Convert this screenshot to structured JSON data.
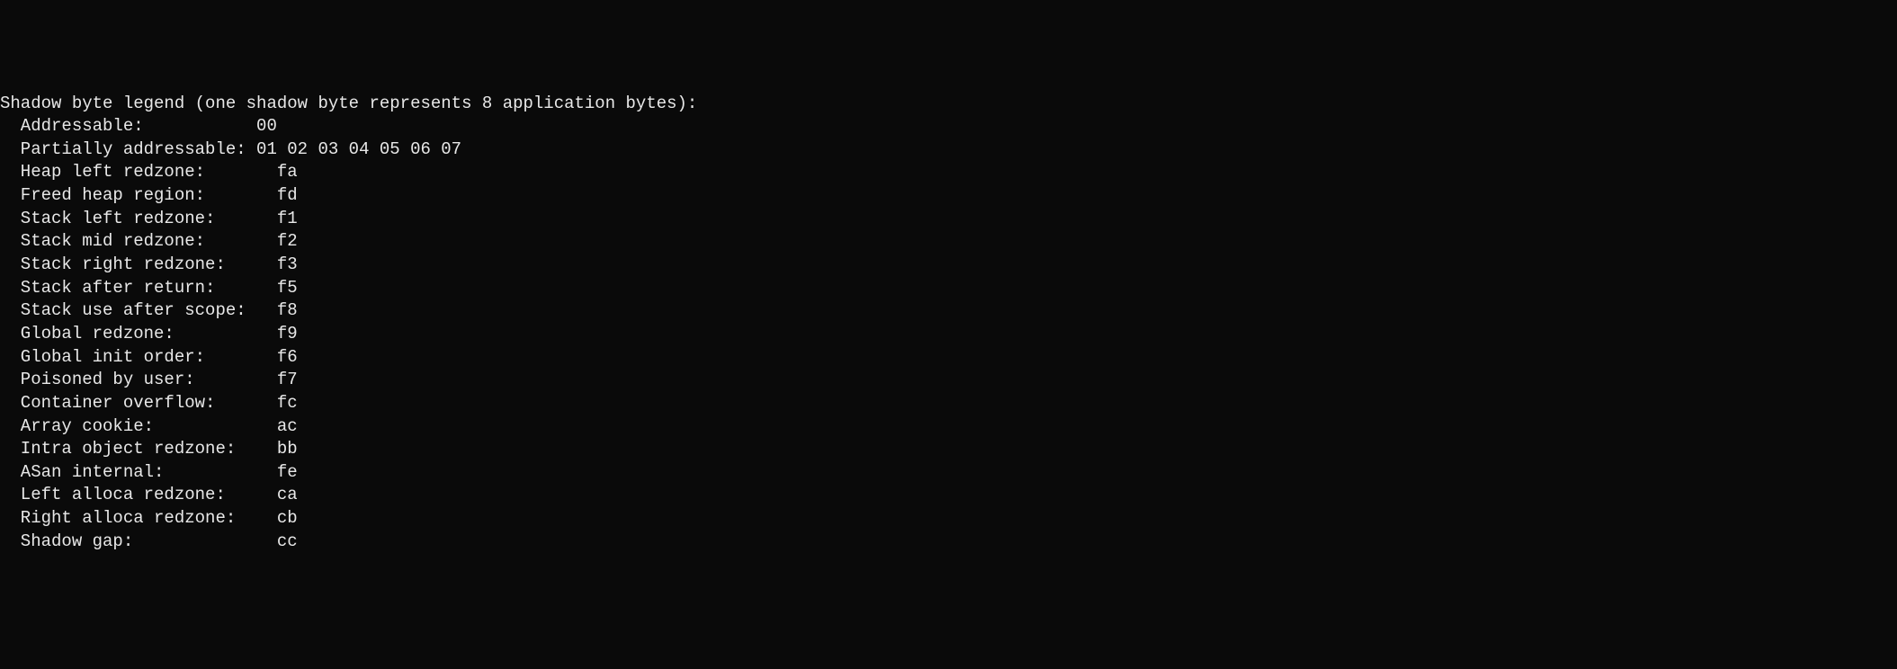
{
  "legend": {
    "title": "Shadow byte legend (one shadow byte represents 8 application bytes):",
    "rows": [
      {
        "label": "  Addressable:           ",
        "value": "00"
      },
      {
        "label": "  Partially addressable: ",
        "value": "01 02 03 04 05 06 07"
      },
      {
        "label": "  Heap left redzone:       ",
        "value": "fa"
      },
      {
        "label": "  Freed heap region:       ",
        "value": "fd"
      },
      {
        "label": "  Stack left redzone:      ",
        "value": "f1"
      },
      {
        "label": "  Stack mid redzone:       ",
        "value": "f2"
      },
      {
        "label": "  Stack right redzone:     ",
        "value": "f3"
      },
      {
        "label": "  Stack after return:      ",
        "value": "f5"
      },
      {
        "label": "  Stack use after scope:   ",
        "value": "f8"
      },
      {
        "label": "  Global redzone:          ",
        "value": "f9"
      },
      {
        "label": "  Global init order:       ",
        "value": "f6"
      },
      {
        "label": "  Poisoned by user:        ",
        "value": "f7"
      },
      {
        "label": "  Container overflow:      ",
        "value": "fc"
      },
      {
        "label": "  Array cookie:            ",
        "value": "ac"
      },
      {
        "label": "  Intra object redzone:    ",
        "value": "bb"
      },
      {
        "label": "  ASan internal:           ",
        "value": "fe"
      },
      {
        "label": "  Left alloca redzone:     ",
        "value": "ca"
      },
      {
        "label": "  Right alloca redzone:    ",
        "value": "cb"
      },
      {
        "label": "  Shadow gap:              ",
        "value": "cc"
      }
    ]
  }
}
